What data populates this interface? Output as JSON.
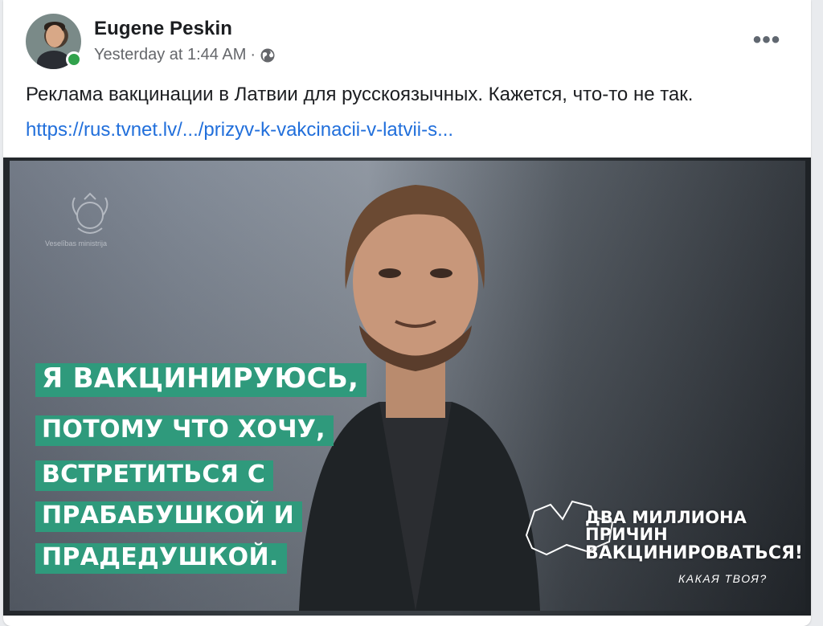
{
  "post": {
    "author": "Eugene Peskin",
    "timestamp": "Yesterday at 1:44 AM",
    "separator": "·",
    "audience_icon": "globe-icon",
    "more_label": "•••",
    "text": "Реклама вакцинации в Латвии для русскоязычных. Кажется, что-то не так.",
    "link": "https://rus.tvnet.lv/.../prizyv-k-vakcinacii-v-latvii-s..."
  },
  "image": {
    "emblem_caption": "Veselības ministrija",
    "caption_lines": [
      "Я ВАКЦИНИРУЮСЬ,",
      "ПОТОМУ ЧТО ХОЧУ,",
      "ВСТРЕТИТЬСЯ С",
      "ПРАБАБУШКОЙ И",
      "ПРАДЕДУШКОЙ."
    ],
    "slogan_lines": [
      "ДВА МИЛЛИОНА",
      "ПРИЧИН",
      "ВАКЦИНИРОВАТЬСЯ!"
    ],
    "slogan_sub": "КАКАЯ ТВОЯ?"
  },
  "colors": {
    "link": "#216fdb",
    "online": "#31a24c",
    "caption_bg": "#2f9a7c",
    "secondary_text": "#65676b"
  }
}
